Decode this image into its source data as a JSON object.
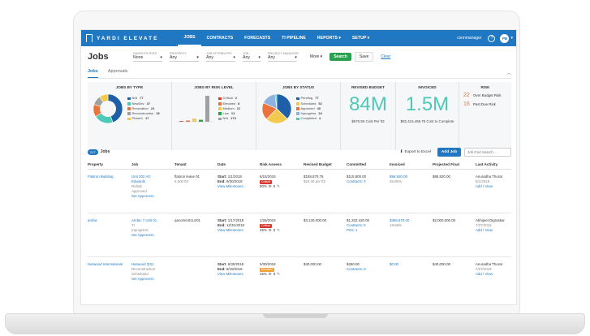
{
  "nav": {
    "logo": "YARDI ELEVATE",
    "items": [
      "JOBS",
      "CONTRACTS",
      "FORECASTS",
      "TI PIPELINE",
      "REPORTS ▾",
      "SETUP ▾"
    ],
    "user": "cxnnmanager",
    "help_icon": "?",
    "avatar": "PB"
  },
  "filters": {
    "title": "Jobs",
    "fields": [
      {
        "label": "SAVED FILTERS",
        "value": "None"
      },
      {
        "label": "PROPERTY",
        "value": "Any"
      },
      {
        "label": "JOB ATTRIBUTES",
        "value": "Any"
      },
      {
        "label": "JOB",
        "value": "Any"
      },
      {
        "label": "PROJECT MANAGER",
        "value": "Any"
      }
    ],
    "more": "More ▾",
    "search": "Search",
    "save": "Save",
    "clear": "Clear"
  },
  "tabs": [
    "Jobs",
    "Approvals"
  ],
  "summary": {
    "by_type": {
      "title": "JOBS BY TYPE",
      "legend": [
        {
          "label": "N/A",
          "value": "77",
          "color": "#1f5fa8"
        },
        {
          "label": "NewDev",
          "value": "37",
          "color": "#4cc9b7"
        },
        {
          "label": "Renovation",
          "value": "24",
          "color": "#e8743b"
        },
        {
          "label": "Reconstruction",
          "value": "18",
          "color": "#a0a0a0"
        },
        {
          "label": "Phase1",
          "value": "17",
          "color": "#f2c94c"
        }
      ]
    },
    "by_risk": {
      "title": "JOBS BY RISK LEVEL",
      "legend": [
        {
          "label": "Critical",
          "value": "2",
          "color": "#d9372c"
        },
        {
          "label": "Elevated",
          "value": "8",
          "color": "#e8743b"
        },
        {
          "label": "Medium",
          "value": "21",
          "color": "#f2c94c"
        },
        {
          "label": "Low",
          "value": "13",
          "color": "#2aa14e"
        },
        {
          "label": "N/A",
          "value": "173",
          "color": "#a0a0a0"
        }
      ]
    },
    "by_status": {
      "title": "JOBS BY STATUS",
      "legend": [
        {
          "label": "Pending",
          "value": "77",
          "color": "#1f5fa8"
        },
        {
          "label": "Scheduled",
          "value": "52",
          "color": "#f2c94c"
        },
        {
          "label": "Approved",
          "value": "40",
          "color": "#e8743b"
        },
        {
          "label": "Inprogress",
          "value": "34",
          "color": "#8fb3e0"
        },
        {
          "label": "Completed",
          "value": "4",
          "color": "#4cc9b7"
        }
      ]
    },
    "budget": {
      "title": "REVISED BUDGET",
      "value": "84M",
      "sub": "$570.50 Cost Per ft2"
    },
    "invoiced": {
      "title": "INVOICED",
      "value": "1.5M",
      "sub": "$82,416,459.76 Cost to Complete"
    },
    "risk": {
      "title": "RISK",
      "items": [
        {
          "num": "22",
          "label": "Over Budget Risk"
        },
        {
          "num": "16",
          "label": "Past Due Risk"
        }
      ]
    }
  },
  "toolbar": {
    "count": "217",
    "jobs_label": "Jobs",
    "export": "Export to Excel",
    "add_job": "Add Job",
    "search_placeholder": "Job Grid Search ..."
  },
  "table": {
    "headers": [
      "Property",
      "Job",
      "Tenant",
      "Date",
      "Risk Assess",
      "Revised Budget",
      "Committed",
      "Invoiced",
      "Projected Final",
      "Last Activity"
    ],
    "rows": [
      {
        "property": "Flatiron Building",
        "job": [
          "Unit 202 AG",
          "Edwards",
          "Rehab",
          "Approved",
          "Set Approvers"
        ],
        "tenant": [
          "flatiron lease 01",
          "6,500 ft2"
        ],
        "start": "1/1/2018",
        "end": "9/30/2018",
        "milestones": "View Milestones",
        "risk_date": "6/15/2018",
        "risk_badge": "Critical",
        "risk_pct": "80%",
        "revised": [
          "$158,570.76",
          "$24.40 per ft2"
        ],
        "committed": [
          "$115,800.00",
          "Contracts: 4"
        ],
        "invoiced": [
          "$56,920.00",
          "35.95%"
        ],
        "projected": "$85,920.00",
        "activity": [
          "Anuradha Thorat",
          "8/1/2018",
          "Add / View"
        ]
      },
      {
        "property": "amfac",
        "job": [
          "Amfac 7 Unit 01",
          "TI",
          "Inprogress",
          "Set Approvers"
        ],
        "tenant": [
          "qacomm01LS01"
        ],
        "start": "1/17/2018",
        "end": "12/31/2018",
        "milestones": "View Milestones",
        "risk_date": "1/26/2018",
        "risk_badge": "Critical",
        "risk_pct": "25%",
        "revised": [
          "$3,130,000.00",
          ""
        ],
        "committed": [
          "$1,332,420.00",
          "Contracts: 5",
          "POs: 1"
        ],
        "invoiced": [
          "$396,670.00",
          "18.68%"
        ],
        "projected": "$2,000,000.00",
        "activity": [
          "Abhijeet Digraskar",
          "7/27/2018",
          "Add / View"
        ]
      },
      {
        "property": "Harwood International",
        "job": [
          "Harwood QS1",
          "Reconstruction",
          "Scheduled",
          "Set Approvers"
        ],
        "tenant": [
          ""
        ],
        "start": "5/30/2018",
        "end": "8/18/2018",
        "milestones": "View Milestones",
        "risk_date": "5/30/2018",
        "risk_badge": "Elevated",
        "risk_pct": "25%",
        "revised": [
          "$40,000.00",
          ""
        ],
        "committed": [
          "$260.00",
          "Contracts: 8"
        ],
        "invoiced": [
          "$0.00",
          ""
        ],
        "projected": "$40,000.00",
        "activity": [
          "Anuradha Thorat",
          "7/27/2018",
          "Add / View"
        ]
      }
    ]
  },
  "chart_data": [
    {
      "type": "pie",
      "title": "JOBS BY TYPE",
      "categories": [
        "N/A",
        "NewDev",
        "Renovation",
        "Reconstruction",
        "Phase1"
      ],
      "values": [
        77,
        37,
        24,
        18,
        17
      ],
      "donut": true
    },
    {
      "type": "bar",
      "title": "JOBS BY RISK LEVEL",
      "categories": [
        "Critical",
        "Elevated",
        "Medium",
        "Low",
        "N/A"
      ],
      "values": [
        2,
        8,
        21,
        13,
        173
      ]
    },
    {
      "type": "pie",
      "title": "JOBS BY STATUS",
      "categories": [
        "Pending",
        "Scheduled",
        "Approved",
        "Inprogress",
        "Completed"
      ],
      "values": [
        77,
        52,
        40,
        34,
        4
      ]
    }
  ]
}
